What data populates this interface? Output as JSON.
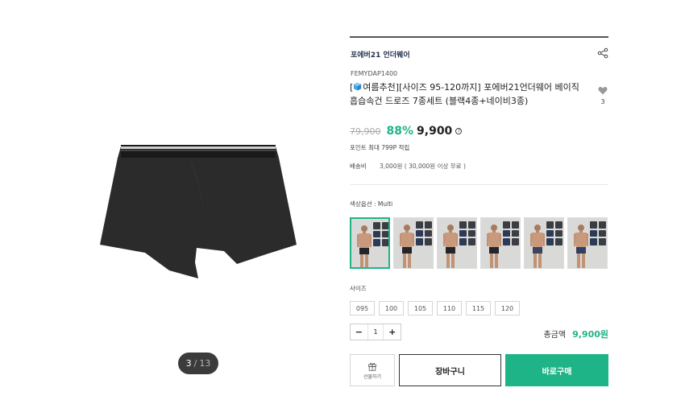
{
  "gallery": {
    "current": "3",
    "separator": "/",
    "total": "13"
  },
  "product": {
    "brand": "포에버21 언더웨어",
    "code": "FEMYDAP1400",
    "title": "여름추천][사이즈 95-120까지] 포에버21언더웨어 베이직 흡습속건 드로즈 7종세트 (블랙4종+네이비3종)",
    "title_prefix": "[",
    "wish_count": "3",
    "original_price": "79,900",
    "discount": "88%",
    "price": "9,900",
    "point_text": "포인트 최대 799P 적립",
    "shipping_label": "배송비",
    "shipping_value": "3,000원 ( 30,000원 이상 무료 )",
    "color_label": "색상옵션 : Multi",
    "color_selected_index": 0,
    "swatch_count": 6,
    "size_label": "사이즈",
    "sizes": [
      "095",
      "100",
      "105",
      "110",
      "115",
      "120"
    ],
    "quantity": "1",
    "total_label": "총금액",
    "total_value": "9,900원"
  },
  "actions": {
    "gift_label": "선물하기",
    "cart_label": "장바구니",
    "buy_label": "바로구매"
  },
  "colors": {
    "accent": "#1fb487",
    "dark": "#3b3b3b",
    "brand": "#23304d"
  },
  "icons": {
    "share": "share-icon",
    "wish": "heart-icon",
    "help": "question-icon",
    "gift": "gift-icon",
    "title": "cube-emoji-icon"
  }
}
